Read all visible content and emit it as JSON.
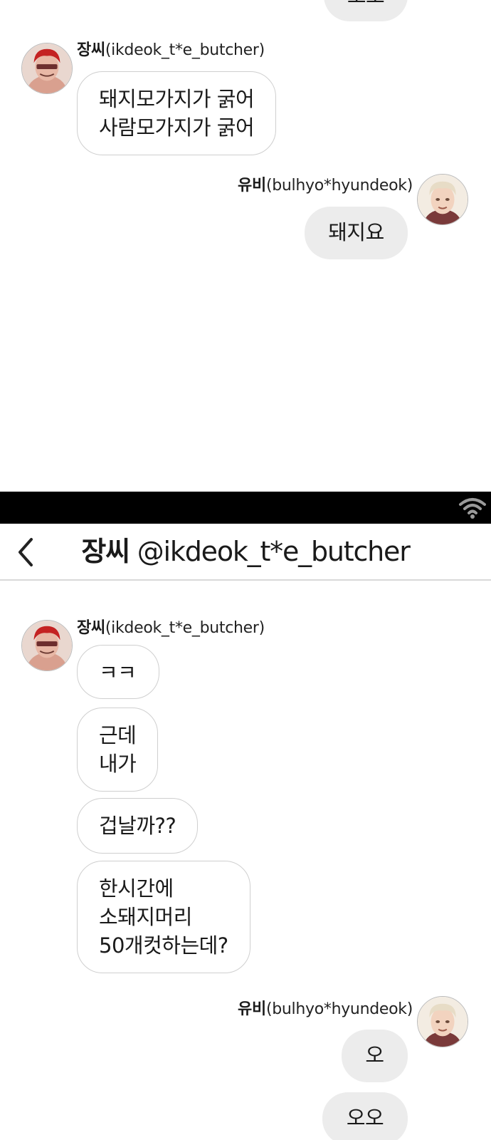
{
  "users": {
    "jang": {
      "nick": "장씨",
      "handle": "(ikdeok_t*e_butcher)"
    },
    "yubi": {
      "nick": "유비",
      "handle": "(bulhyo*hyundeok)"
    }
  },
  "top_section": {
    "partial_bubble_text": "오오",
    "jang_message": {
      "lines": [
        "돼지모가지가 굵어",
        "사람모가지가 굵어"
      ]
    },
    "yubi_message": {
      "text": "돼지요"
    }
  },
  "nav": {
    "nick": "장씨",
    "handle": " @ikdeok_t*e_butcher",
    "back_icon": "chevron-left-icon",
    "wifi_icon": "wifi-icon"
  },
  "bottom_section": {
    "jang_messages": [
      {
        "lines": [
          "ㅋㅋ"
        ]
      },
      {
        "lines": [
          "근데",
          "내가"
        ]
      },
      {
        "lines": [
          "겁날까??"
        ]
      },
      {
        "lines": [
          "한시간에",
          "소돼지머리",
          "50개컷하는데?"
        ]
      }
    ],
    "yubi_messages": [
      {
        "text": "오"
      },
      {
        "text": "오오"
      }
    ]
  },
  "colors": {
    "status_bar": "#000000",
    "outgoing_bubble": "#ececec",
    "incoming_border": "#cfcfcf",
    "jang_hair": "#c42222"
  }
}
